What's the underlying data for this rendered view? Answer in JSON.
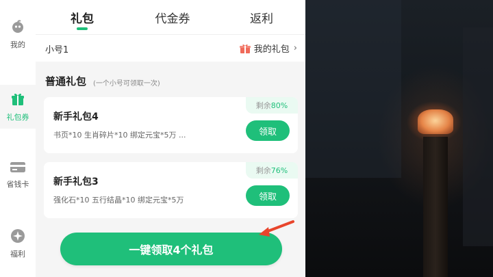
{
  "tabs": [
    "礼包",
    "代金券",
    "返利"
  ],
  "sidebar": {
    "items": [
      {
        "label": "我的",
        "icon": "fruit-avatar-icon"
      },
      {
        "label": "礼包券",
        "icon": "gift-icon"
      },
      {
        "label": "省钱卡",
        "icon": "card-icon"
      },
      {
        "label": "福利",
        "icon": "sparkle-icon"
      }
    ]
  },
  "account": {
    "name": "小号1",
    "my_gifts_label": "我的礼包",
    "chevron": "›"
  },
  "section": {
    "title": "普通礼包",
    "subtitle": "(一个小号可领取一次)"
  },
  "gifts": [
    {
      "name": "新手礼包4",
      "items": "书页*10    生肖碎片*10 绑定元宝*5万 ...",
      "remain_label": "剩余",
      "remain_pct": "80%",
      "claim_label": "领取"
    },
    {
      "name": "新手礼包3",
      "items": "强化石*10    五行结晶*10 绑定元宝*5万",
      "remain_label": "剩余",
      "remain_pct": "76%",
      "claim_label": "领取"
    }
  ],
  "one_click_label": "一键领取4个礼包",
  "colors": {
    "accent": "#1fbf7a",
    "badge_bg": "#eafaf2",
    "arrow": "#e8452c"
  }
}
